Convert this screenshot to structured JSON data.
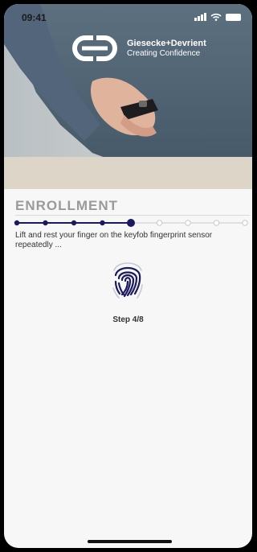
{
  "status_bar": {
    "time": "09:41",
    "icons": [
      "signal-icon",
      "wifi-icon",
      "battery-icon"
    ]
  },
  "brand": {
    "name": "Giesecke+Devrient",
    "tagline": "Creating Confidence",
    "logo_icon": "gd-logo-mark"
  },
  "enrollment": {
    "title": "ENROLLMENT",
    "instruction": "Lift and rest your finger on the keyfob fingerprint sensor repeatedly ...",
    "step_label": "Step 4/8",
    "icon": "fingerprint-icon",
    "progress": {
      "current": 5,
      "total": 9
    }
  },
  "colors": {
    "accent": "#1a1a5e",
    "inactive": "#c9c9c9",
    "title": "#9a9a9a",
    "background": "#f7f7f7"
  }
}
